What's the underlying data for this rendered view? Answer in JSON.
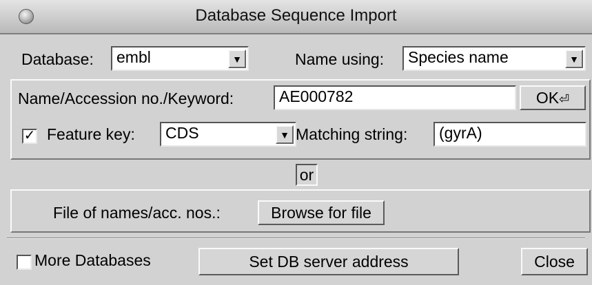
{
  "window": {
    "title": "Database Sequence Import",
    "close_icon": "close-dot-icon"
  },
  "row1": {
    "database_label": "Database:",
    "database_value": "embl",
    "name_using_label": "Name using:",
    "name_using_value": "Species name"
  },
  "query": {
    "label": "Name/Accession no./Keyword:",
    "value": "AE000782",
    "ok_label": "OK",
    "ok_icon": "return-key-icon"
  },
  "feature": {
    "checked": true,
    "check_mark": "✓",
    "key_label": "Feature key:",
    "key_value": "CDS",
    "matching_label": "Matching string:",
    "matching_value": "(gyrA)"
  },
  "or_label": "or",
  "file": {
    "label": "File of names/acc. nos.:",
    "browse_label": "Browse for file"
  },
  "footer": {
    "more_databases_label": "More Databases",
    "more_databases_checked": false,
    "set_server_label": "Set DB server address",
    "close_label": "Close"
  }
}
